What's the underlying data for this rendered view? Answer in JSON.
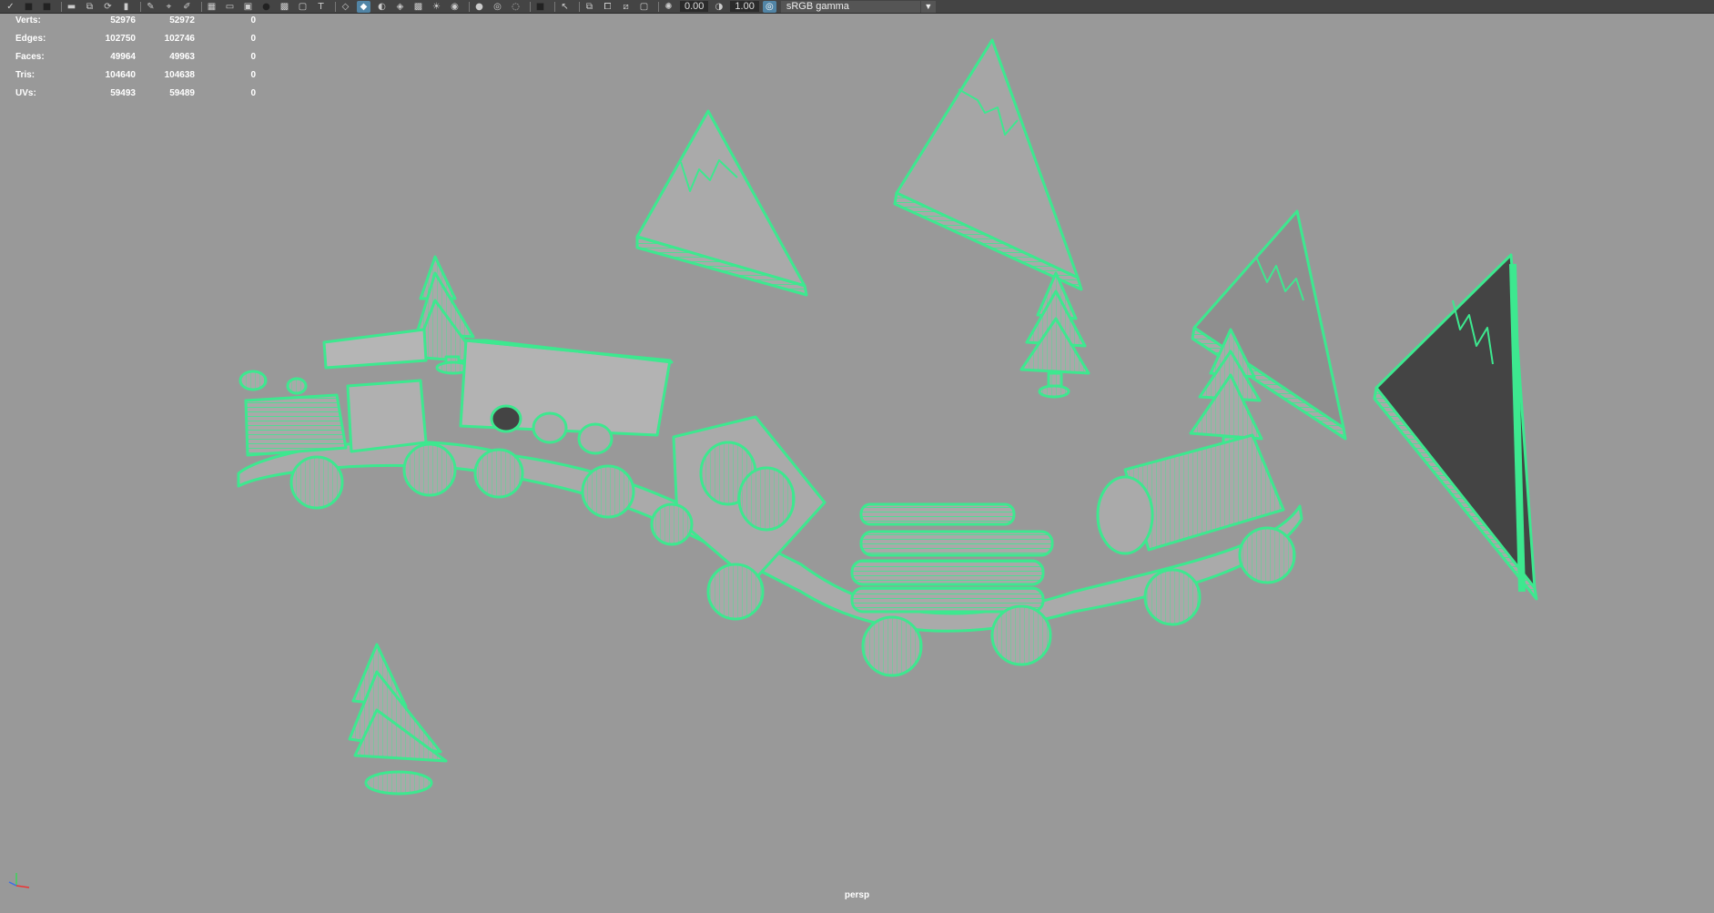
{
  "toolbar": {
    "icons": [
      "select-mode-icon",
      "camera-icon",
      "camera-attributes-icon",
      "bookmark-icon",
      "image-plane-icon",
      "grid-icon",
      "film-gate-icon",
      "resolution-gate-icon",
      "gate-mask-icon",
      "field-chart-icon",
      "safe-action-icon",
      "safe-title-icon",
      "wireframe-icon",
      "smooth-shade-icon",
      "default-material-icon",
      "textured-icon",
      "use-lights-icon",
      "shadows-icon",
      "ambient-occlusion-icon",
      "motion-blur-icon",
      "anti-aliasing-icon",
      "depth-of-field-icon",
      "isolate-select-icon",
      "xray-icon",
      "xray-joints-icon",
      "exposure-icon",
      "gamma-icon",
      "color-management-icon"
    ],
    "exposure_value": "0.00",
    "gamma_value": "1.00",
    "color_space": "sRGB gamma"
  },
  "hud": {
    "rows": [
      {
        "label": "Verts:",
        "c1": "52976",
        "c2": "52972",
        "c3": "0"
      },
      {
        "label": "Edges:",
        "c1": "102750",
        "c2": "102746",
        "c3": "0"
      },
      {
        "label": "Faces:",
        "c1": "49964",
        "c2": "49963",
        "c3": "0"
      },
      {
        "label": "Tris:",
        "c1": "104640",
        "c2": "104638",
        "c3": "0"
      },
      {
        "label": "UVs:",
        "c1": "59493",
        "c2": "59489",
        "c3": "0"
      }
    ]
  },
  "viewport": {
    "camera": "persp",
    "wire_color": "#3de88f",
    "bg_color": "#999999"
  }
}
